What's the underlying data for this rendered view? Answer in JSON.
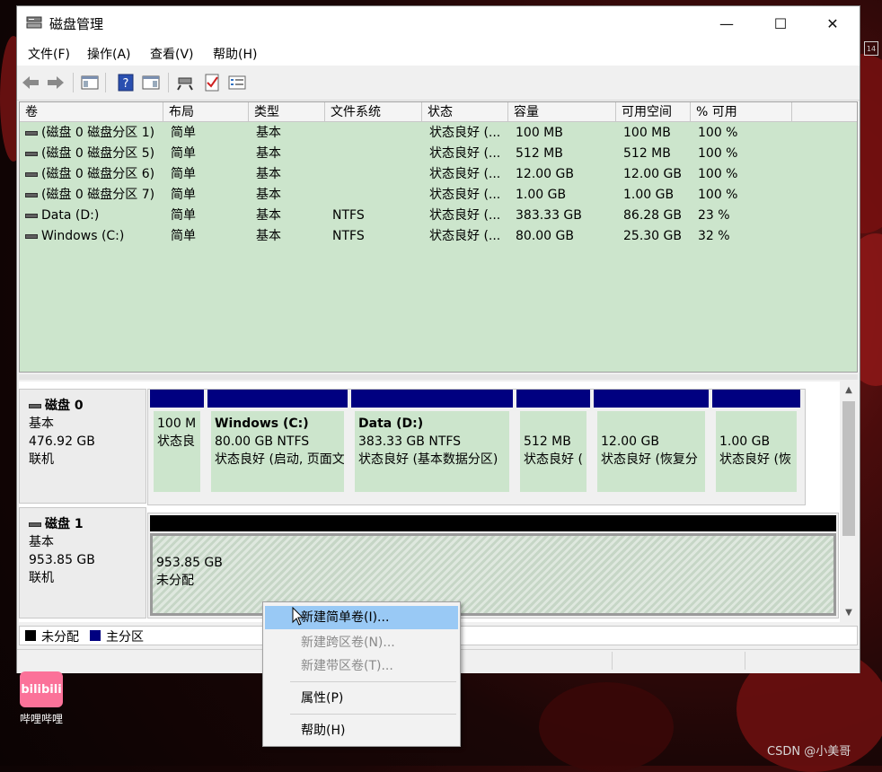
{
  "window": {
    "title": "磁盘管理",
    "minimize_glyph": "—",
    "maximize_glyph": "☐",
    "close_glyph": "✕"
  },
  "menu": [
    "文件(F)",
    "操作(A)",
    "查看(V)",
    "帮助(H)"
  ],
  "toolbar_icons": [
    "back-arrow-icon",
    "forward-arrow-icon",
    "console-tree-icon",
    "help-icon",
    "action-pane-icon",
    "connect-icon",
    "checklist-icon",
    "properties-list-icon"
  ],
  "volume_table": {
    "columns": [
      "卷",
      "布局",
      "类型",
      "文件系统",
      "状态",
      "容量",
      "可用空间",
      "% 可用"
    ],
    "rows": [
      [
        "(磁盘 0 磁盘分区 1)",
        "简单",
        "基本",
        "",
        "状态良好 (...",
        "100 MB",
        "100 MB",
        "100 %"
      ],
      [
        "(磁盘 0 磁盘分区 5)",
        "简单",
        "基本",
        "",
        "状态良好 (...",
        "512 MB",
        "512 MB",
        "100 %"
      ],
      [
        "(磁盘 0 磁盘分区 6)",
        "简单",
        "基本",
        "",
        "状态良好 (...",
        "12.00 GB",
        "12.00 GB",
        "100 %"
      ],
      [
        "(磁盘 0 磁盘分区 7)",
        "简单",
        "基本",
        "",
        "状态良好 (...",
        "1.00 GB",
        "1.00 GB",
        "100 %"
      ],
      [
        "Data (D:)",
        "简单",
        "基本",
        "NTFS",
        "状态良好 (...",
        "383.33 GB",
        "86.28 GB",
        "23 %"
      ],
      [
        "Windows (C:)",
        "简单",
        "基本",
        "NTFS",
        "状态良好 (...",
        "80.00 GB",
        "25.30 GB",
        "32 %"
      ]
    ]
  },
  "disks": [
    {
      "name": "磁盘 0",
      "type": "基本",
      "size": "476.92 GB",
      "status": "联机",
      "partitions": [
        {
          "title": "",
          "line1": "100 M",
          "line2": "状态良"
        },
        {
          "title": "Windows  (C:)",
          "line1": "80.00 GB NTFS",
          "line2": "状态良好 (启动, 页面文"
        },
        {
          "title": "Data  (D:)",
          "line1": "383.33 GB NTFS",
          "line2": "状态良好 (基本数据分区)"
        },
        {
          "title": "",
          "line1": "512 MB",
          "line2": "状态良好 ("
        },
        {
          "title": "",
          "line1": "12.00 GB",
          "line2": "状态良好 (恢复分"
        },
        {
          "title": "",
          "line1": "1.00 GB",
          "line2": "状态良好 (恢"
        }
      ]
    },
    {
      "name": "磁盘 1",
      "type": "基本",
      "size": "953.85 GB",
      "status": "联机",
      "partitions": [
        {
          "title": "",
          "line1": "953.85 GB",
          "line2": "未分配"
        }
      ]
    }
  ],
  "legend": [
    {
      "label": "未分配",
      "color": "#000000"
    },
    {
      "label": "主分区",
      "color": "#000080"
    }
  ],
  "context_menu": [
    {
      "label": "新建简单卷(I)...",
      "enabled": true,
      "highlighted": true
    },
    {
      "label": "新建跨区卷(N)...",
      "enabled": false
    },
    {
      "label": "新建带区卷(T)...",
      "enabled": false
    },
    {
      "label": "属性(P)",
      "enabled": true
    },
    {
      "label": "帮助(H)",
      "enabled": true
    }
  ],
  "desktop": {
    "app_icon_text": "bilibili",
    "app_label": "哔哩哔哩",
    "calendar_day": "14",
    "watermark": "CSDN @小美哥"
  },
  "colors": {
    "primary_partition_bar": "#000080",
    "unallocated_bar": "#000000",
    "volume_bg": "#cce5cc",
    "menu_highlight": "#99c9f5"
  }
}
